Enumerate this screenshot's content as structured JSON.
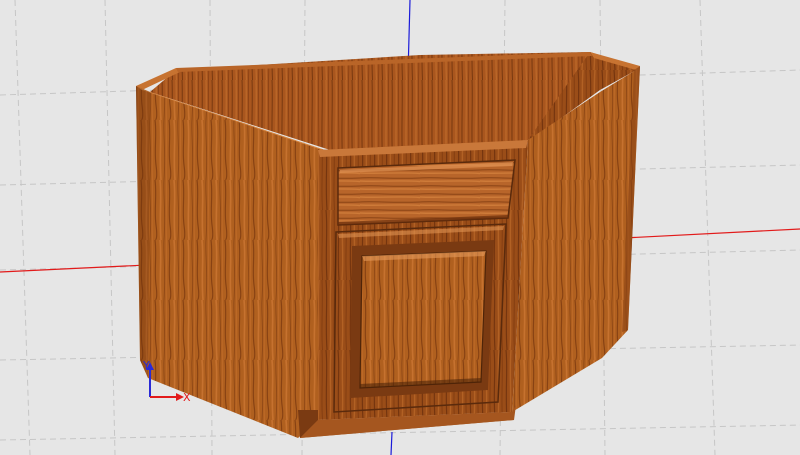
{
  "viewport": {
    "background": "#e6e6e6",
    "grid_color": "#c8c8c8",
    "grid_dash": true
  },
  "axes": {
    "x_axis_color": "#e21a1a",
    "z_axis_color": "#1b1bd9",
    "triad": {
      "x_label": "X",
      "y_label": "Y",
      "x_color": "#e21a1a",
      "y_color": "#2a2ad6"
    }
  },
  "model": {
    "object": "corner-base-cabinet",
    "material": "oak",
    "wood_colors": {
      "light": "#c4702f",
      "mid": "#a85a24",
      "dark": "#7a3a12",
      "edge": "#5a2a0c"
    },
    "parts": [
      "left-side-panel",
      "interior-back-panel",
      "top-rim",
      "drawer-front",
      "raised-panel-door",
      "face-frame",
      "right-side-panel",
      "toe-kick"
    ]
  }
}
